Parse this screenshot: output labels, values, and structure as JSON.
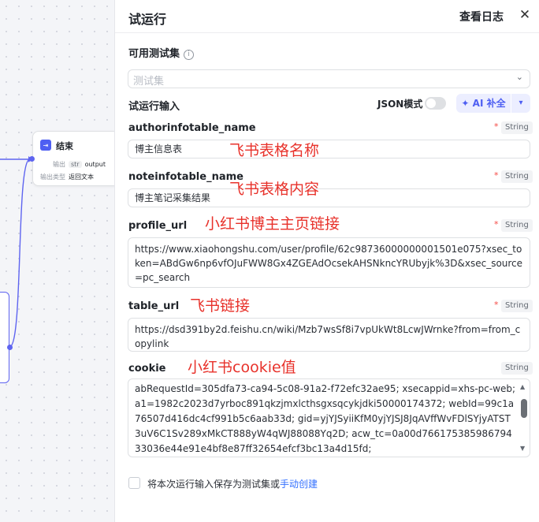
{
  "canvas": {
    "end_node": {
      "title": "结束",
      "output_label": "输出",
      "output_tag": "str",
      "output_value": "output",
      "output_type_label": "输出类型",
      "output_type_value": "返回文本"
    }
  },
  "panel": {
    "title": "试运行",
    "view_log": "查看日志",
    "close_icon": "close-icon",
    "test_set_label": "可用测试集",
    "test_set_placeholder": "测试集",
    "input_label": "试运行输入",
    "json_mode_label": "JSON模式",
    "json_mode_on": false,
    "ai_button_label": "AI 补全",
    "accent_color": "#4e5ff2",
    "fields": [
      {
        "name": "authorinfotable_name",
        "required": true,
        "type": "String",
        "value": "博主信息表",
        "annotation": "飞书表格名称"
      },
      {
        "name": "noteinfotable_name",
        "required": true,
        "type": "String",
        "value": "博主笔记采集结果",
        "annotation": "飞书表格内容"
      },
      {
        "name": "profile_url",
        "required": true,
        "type": "String",
        "value": "https://www.xiaohongshu.com/user/profile/62c98736000000001501e075?xsec_token=ABdGw6np6vfOJuFWW8Gx4ZGEAdOcsekAHSNkncYRUbyjk%3D&xsec_source=pc_search",
        "annotation": "小红书博主主页链接"
      },
      {
        "name": "table_url",
        "required": true,
        "type": "String",
        "value": "https://dsd391by2d.feishu.cn/wiki/Mzb7wsSf8i7vpUkWt8LcwJWrnke?from=from_copylink",
        "annotation": "飞书链接"
      },
      {
        "name": "cookie",
        "required": false,
        "type": "String",
        "value": "abRequestId=305dfa73-ca94-5c08-91a2-f72efc32ae95; xsecappid=xhs-pc-web; a1=1982c2023d7yrboc891qkzjmxlcthsgxsqcykjdki50000174372; webId=99c1a76507d416dc4cf991b5c6aab33d; gid=yjYJSyiiKfM0yjYJSJ8JqAVffWvFDlSYjyATST3uV6C1Sv289xMkCT888yW4qWJ88088Yq2D; acw_tc=0a00d76617538598679433036e44e91e4bf8e87ff32654efcf3bc13a4d15fd;",
        "annotation": "小红书cookie值"
      }
    ],
    "save_text": "将本次运行输入保存为测试集或",
    "save_link": "手动创建"
  }
}
